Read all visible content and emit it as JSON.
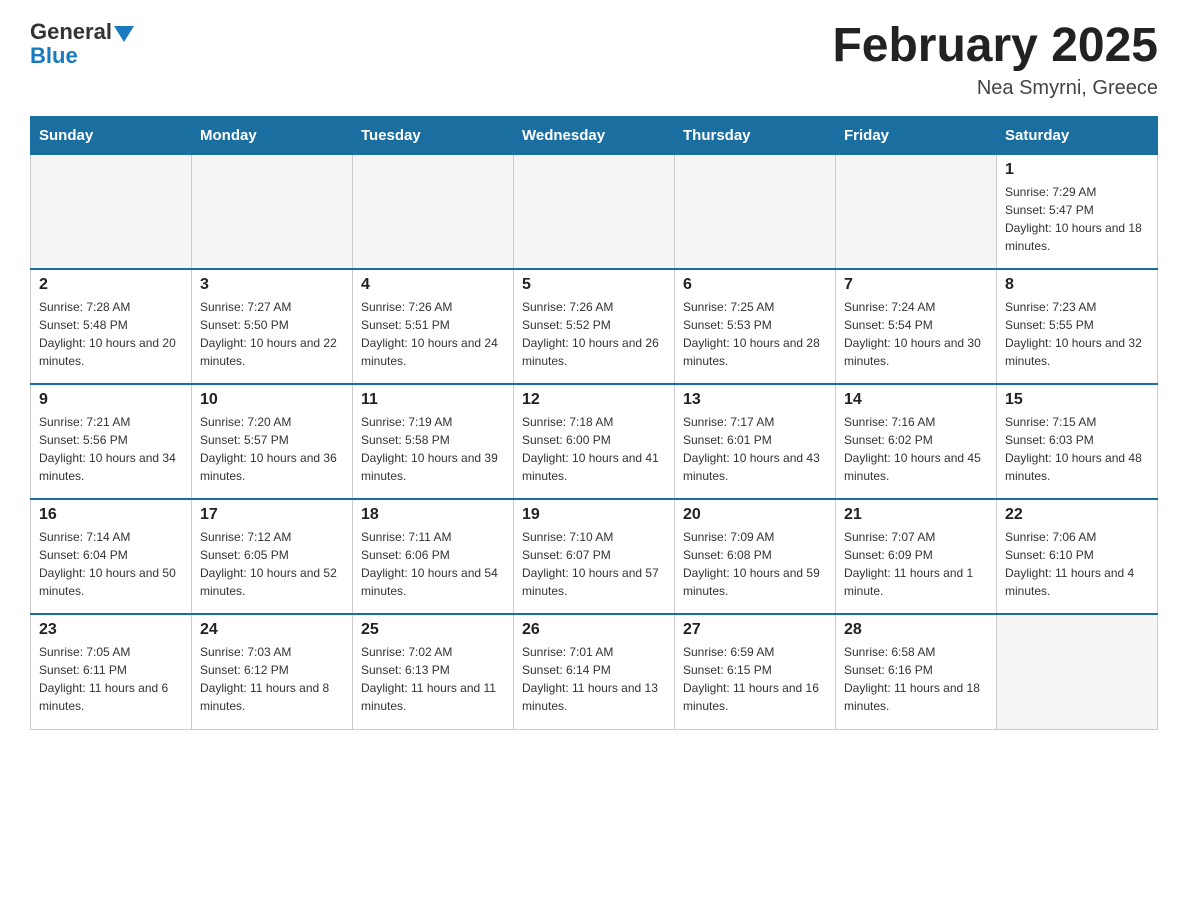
{
  "header": {
    "logo_line1": "General",
    "logo_line2": "Blue",
    "month_title": "February 2025",
    "location": "Nea Smyrni, Greece"
  },
  "days_of_week": [
    "Sunday",
    "Monday",
    "Tuesday",
    "Wednesday",
    "Thursday",
    "Friday",
    "Saturday"
  ],
  "weeks": [
    [
      {
        "day": "",
        "empty": true
      },
      {
        "day": "",
        "empty": true
      },
      {
        "day": "",
        "empty": true
      },
      {
        "day": "",
        "empty": true
      },
      {
        "day": "",
        "empty": true
      },
      {
        "day": "",
        "empty": true
      },
      {
        "day": "1",
        "sunrise": "7:29 AM",
        "sunset": "5:47 PM",
        "daylight": "10 hours and 18 minutes."
      }
    ],
    [
      {
        "day": "2",
        "sunrise": "7:28 AM",
        "sunset": "5:48 PM",
        "daylight": "10 hours and 20 minutes."
      },
      {
        "day": "3",
        "sunrise": "7:27 AM",
        "sunset": "5:50 PM",
        "daylight": "10 hours and 22 minutes."
      },
      {
        "day": "4",
        "sunrise": "7:26 AM",
        "sunset": "5:51 PM",
        "daylight": "10 hours and 24 minutes."
      },
      {
        "day": "5",
        "sunrise": "7:26 AM",
        "sunset": "5:52 PM",
        "daylight": "10 hours and 26 minutes."
      },
      {
        "day": "6",
        "sunrise": "7:25 AM",
        "sunset": "5:53 PM",
        "daylight": "10 hours and 28 minutes."
      },
      {
        "day": "7",
        "sunrise": "7:24 AM",
        "sunset": "5:54 PM",
        "daylight": "10 hours and 30 minutes."
      },
      {
        "day": "8",
        "sunrise": "7:23 AM",
        "sunset": "5:55 PM",
        "daylight": "10 hours and 32 minutes."
      }
    ],
    [
      {
        "day": "9",
        "sunrise": "7:21 AM",
        "sunset": "5:56 PM",
        "daylight": "10 hours and 34 minutes."
      },
      {
        "day": "10",
        "sunrise": "7:20 AM",
        "sunset": "5:57 PM",
        "daylight": "10 hours and 36 minutes."
      },
      {
        "day": "11",
        "sunrise": "7:19 AM",
        "sunset": "5:58 PM",
        "daylight": "10 hours and 39 minutes."
      },
      {
        "day": "12",
        "sunrise": "7:18 AM",
        "sunset": "6:00 PM",
        "daylight": "10 hours and 41 minutes."
      },
      {
        "day": "13",
        "sunrise": "7:17 AM",
        "sunset": "6:01 PM",
        "daylight": "10 hours and 43 minutes."
      },
      {
        "day": "14",
        "sunrise": "7:16 AM",
        "sunset": "6:02 PM",
        "daylight": "10 hours and 45 minutes."
      },
      {
        "day": "15",
        "sunrise": "7:15 AM",
        "sunset": "6:03 PM",
        "daylight": "10 hours and 48 minutes."
      }
    ],
    [
      {
        "day": "16",
        "sunrise": "7:14 AM",
        "sunset": "6:04 PM",
        "daylight": "10 hours and 50 minutes."
      },
      {
        "day": "17",
        "sunrise": "7:12 AM",
        "sunset": "6:05 PM",
        "daylight": "10 hours and 52 minutes."
      },
      {
        "day": "18",
        "sunrise": "7:11 AM",
        "sunset": "6:06 PM",
        "daylight": "10 hours and 54 minutes."
      },
      {
        "day": "19",
        "sunrise": "7:10 AM",
        "sunset": "6:07 PM",
        "daylight": "10 hours and 57 minutes."
      },
      {
        "day": "20",
        "sunrise": "7:09 AM",
        "sunset": "6:08 PM",
        "daylight": "10 hours and 59 minutes."
      },
      {
        "day": "21",
        "sunrise": "7:07 AM",
        "sunset": "6:09 PM",
        "daylight": "11 hours and 1 minute."
      },
      {
        "day": "22",
        "sunrise": "7:06 AM",
        "sunset": "6:10 PM",
        "daylight": "11 hours and 4 minutes."
      }
    ],
    [
      {
        "day": "23",
        "sunrise": "7:05 AM",
        "sunset": "6:11 PM",
        "daylight": "11 hours and 6 minutes."
      },
      {
        "day": "24",
        "sunrise": "7:03 AM",
        "sunset": "6:12 PM",
        "daylight": "11 hours and 8 minutes."
      },
      {
        "day": "25",
        "sunrise": "7:02 AM",
        "sunset": "6:13 PM",
        "daylight": "11 hours and 11 minutes."
      },
      {
        "day": "26",
        "sunrise": "7:01 AM",
        "sunset": "6:14 PM",
        "daylight": "11 hours and 13 minutes."
      },
      {
        "day": "27",
        "sunrise": "6:59 AM",
        "sunset": "6:15 PM",
        "daylight": "11 hours and 16 minutes."
      },
      {
        "day": "28",
        "sunrise": "6:58 AM",
        "sunset": "6:16 PM",
        "daylight": "11 hours and 18 minutes."
      },
      {
        "day": "",
        "empty": true
      }
    ]
  ]
}
